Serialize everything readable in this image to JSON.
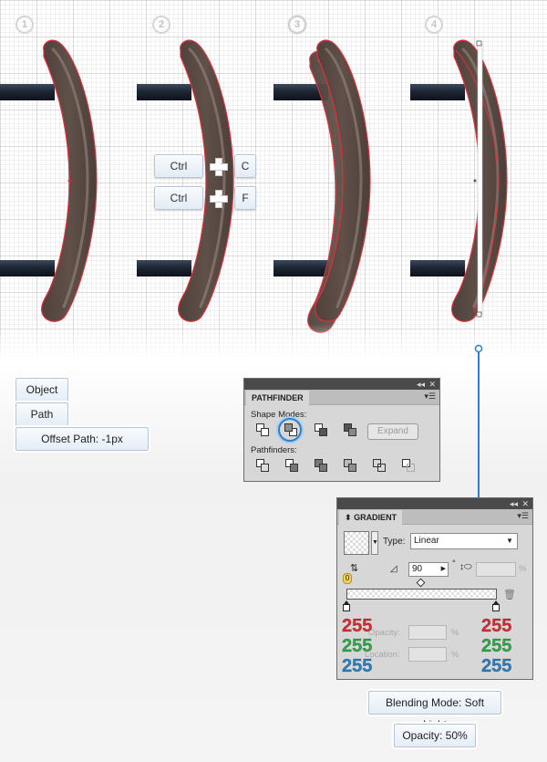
{
  "steps": [
    "1",
    "2",
    "3",
    "4"
  ],
  "shortcuts": [
    {
      "modifier": "Ctrl",
      "key": "C"
    },
    {
      "modifier": "Ctrl",
      "key": "F"
    }
  ],
  "menu_path": {
    "object": "Object",
    "path": "Path",
    "offset_path": "Offset Path: -1px"
  },
  "pathfinder": {
    "title": "PATHFINDER",
    "shape_modes_label": "Shape Modes:",
    "pathfinders_label": "Pathfinders:",
    "expand_label": "Expand",
    "selected_mode": "minus-front"
  },
  "gradient": {
    "title": "GRADIENT",
    "type_label": "Type:",
    "type_value": "Linear",
    "angle_value": "90",
    "angle_unit": "°",
    "aspect_unit": "%",
    "opacity_label": "Opacity:",
    "location_label": "Location:",
    "percent": "%",
    "left_stop": {
      "r": "255",
      "g": "255",
      "b": "255"
    },
    "right_stop": {
      "r": "255",
      "g": "255",
      "b": "255"
    }
  },
  "notes": {
    "blending_mode": "Blending Mode: Soft Light",
    "opacity": "Opacity: 50%"
  },
  "colors": {
    "shape_fill": "#5a4b46",
    "shape_outline": "#e0303a",
    "bar": "#1b2430",
    "rgb_red": "#e02b33",
    "rgb_green": "#2fae4a",
    "rgb_blue": "#2b83c6",
    "accent": "#2d7fd0"
  }
}
